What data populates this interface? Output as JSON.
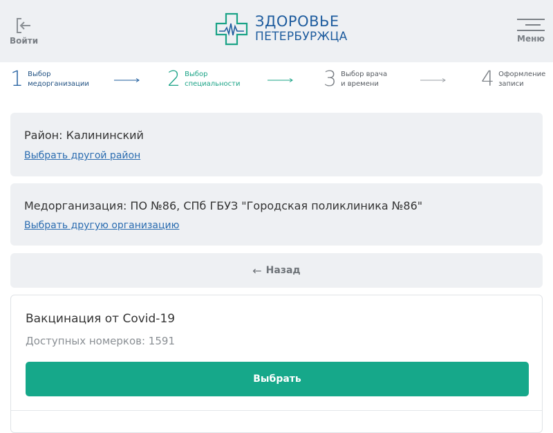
{
  "header": {
    "login_label": "Войти",
    "logo_line1": "ЗДОРОВЬЕ",
    "logo_line2": "ПЕТЕРБУРЖЦА",
    "menu_label": "Меню"
  },
  "steps": [
    {
      "num": "1",
      "line1": "Выбор",
      "line2": "медорганизации",
      "state": "done"
    },
    {
      "num": "2",
      "line1": "Выбор",
      "line2": "специальности",
      "state": "active"
    },
    {
      "num": "3",
      "line1": "Выбор врача",
      "line2": "и времени",
      "state": "pending"
    },
    {
      "num": "4",
      "line1": "Оформление",
      "line2": "записи",
      "state": "pending"
    }
  ],
  "district": {
    "title": "Район: Калининский",
    "change_link": "Выбрать другой район"
  },
  "organization": {
    "title": "Медорганизация: ПО №86, СПб ГБУЗ \"Городская поликлиника №86\"",
    "change_link": "Выбрать другую организацию"
  },
  "back": {
    "arrow": "←",
    "label": "Назад"
  },
  "service": {
    "name": "Вакцинация от Covid-19",
    "available": "Доступных номерков: 1591",
    "select_label": "Выбрать"
  },
  "colors": {
    "accent_green": "#16a88a",
    "brand_blue": "#1e5c9e",
    "panel_bg": "#eef0f3"
  }
}
